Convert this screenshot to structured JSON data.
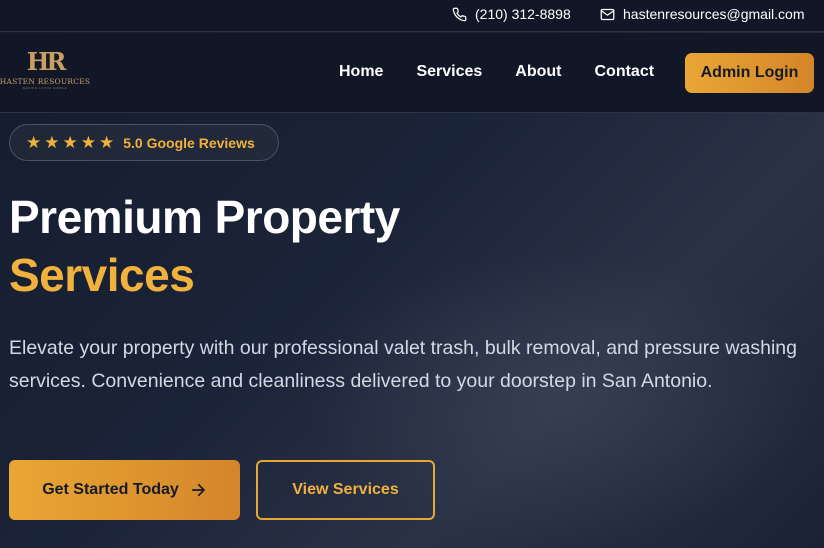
{
  "topbar": {
    "phone": "(210) 312-8898",
    "email": "hastenresources@gmail.com",
    "phone_icon": "phone-icon",
    "email_icon": "mail-icon"
  },
  "nav": {
    "logo_mark": "HR",
    "logo_text": "HASTEN RESOURCES",
    "logo_sub": "MAKING LIVING SIMPLE",
    "links": [
      "Home",
      "Services",
      "About",
      "Contact"
    ],
    "admin_label": "Admin Login"
  },
  "reviews": {
    "stars": 5,
    "label": "5.0 Google Reviews"
  },
  "hero": {
    "title_line1": "Premium Property",
    "title_line2": "Services",
    "description": "Elevate your property with our professional valet trash, bulk removal, and pressure washing services. Convenience and cleanliness delivered to your doorstep in San Antonio.",
    "primary_cta": "Get Started Today",
    "secondary_cta": "View Services"
  },
  "colors": {
    "accent": "#f0b23c",
    "accent_dark": "#d4852a",
    "background": "#1b2438"
  }
}
